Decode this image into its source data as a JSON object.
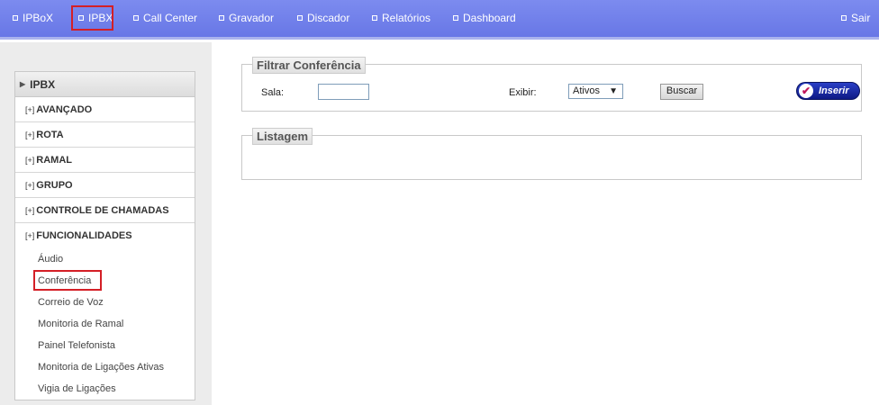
{
  "topnav": {
    "items": [
      {
        "label": "IPBoX"
      },
      {
        "label": "IPBX"
      },
      {
        "label": "Call Center"
      },
      {
        "label": "Gravador"
      },
      {
        "label": "Discador"
      },
      {
        "label": "Relatórios"
      },
      {
        "label": "Dashboard"
      }
    ],
    "exit_label": "Sair"
  },
  "sidebar": {
    "header": "IPBX",
    "sections": [
      {
        "label": "AVANÇADO"
      },
      {
        "label": "ROTA"
      },
      {
        "label": "RAMAL"
      },
      {
        "label": "GRUPO"
      },
      {
        "label": "CONTROLE DE CHAMADAS"
      },
      {
        "label": "FUNCIONALIDADES"
      }
    ],
    "expand_glyph": "[+]",
    "sub_items": [
      {
        "label": "Áudio"
      },
      {
        "label": "Conferência"
      },
      {
        "label": "Correio de Voz"
      },
      {
        "label": "Monitoria de Ramal"
      },
      {
        "label": "Painel Telefonista"
      },
      {
        "label": "Monitoria de Ligações Ativas"
      },
      {
        "label": "Vigia de Ligações"
      }
    ]
  },
  "filter": {
    "legend": "Filtrar Conferência",
    "sala_label": "Sala:",
    "sala_value": "",
    "exibir_label": "Exibir:",
    "exibir_value": "Ativos",
    "search_button": "Buscar",
    "insert_button": "Inserir"
  },
  "listing": {
    "legend": "Listagem"
  },
  "colors": {
    "nav_bg": "#6f7eea",
    "highlight": "#d41f26",
    "insert_button": "#1a2aa8"
  }
}
